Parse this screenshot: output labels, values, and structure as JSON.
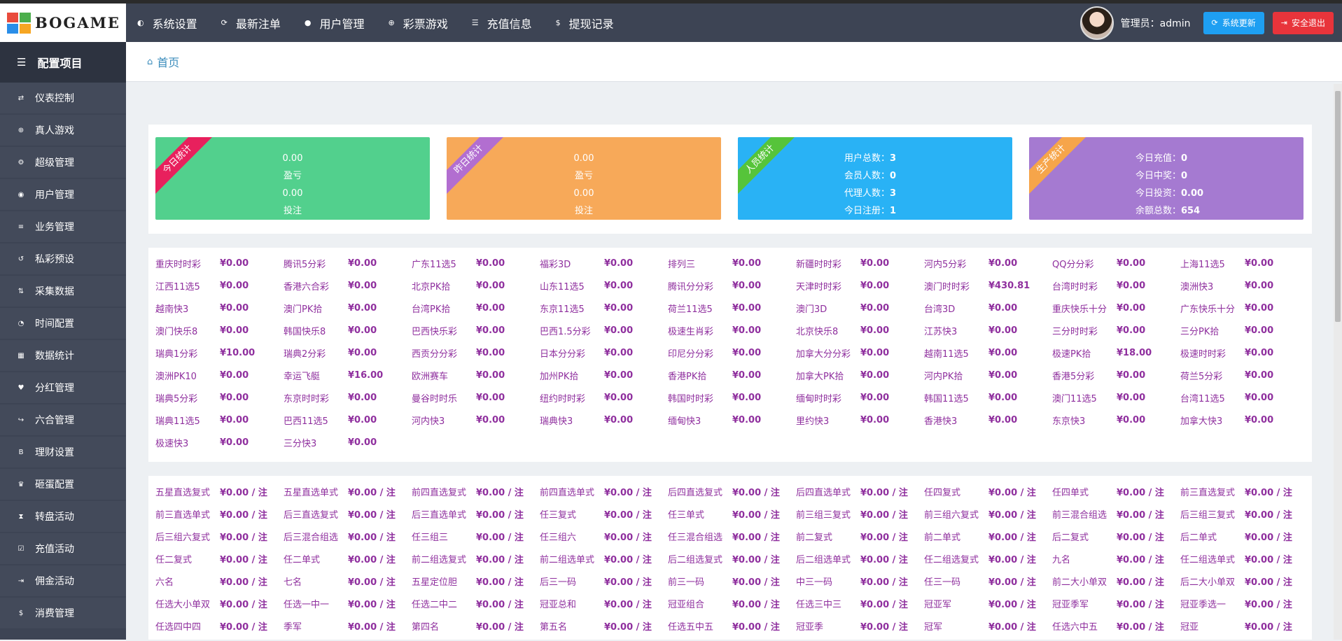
{
  "header": {
    "logo_text": "BOGAME",
    "logo_colors": [
      "#e94b3c",
      "#f6a623",
      "#4cae4c",
      "#2a8ee8"
    ],
    "nav": [
      {
        "label": "系统设置",
        "icon": "toggle-icon"
      },
      {
        "label": "最新注单",
        "icon": "refresh-icon"
      },
      {
        "label": "用户管理",
        "icon": "user-icon"
      },
      {
        "label": "彩票游戏",
        "icon": "plus-circle-icon"
      },
      {
        "label": "充值信息",
        "icon": "list-icon"
      },
      {
        "label": "提现记录",
        "icon": "dollar-icon"
      }
    ],
    "admin_label": "管理员：admin",
    "update_button": "系统更新",
    "logout_button": "安全退出"
  },
  "sidebar": {
    "title": "配置项目",
    "items": [
      {
        "label": "仪表控制",
        "icon": "shuffle-icon"
      },
      {
        "label": "真人游戏",
        "icon": "plus-circle-icon"
      },
      {
        "label": "超级管理",
        "icon": "gear-icon"
      },
      {
        "label": "用户管理",
        "icon": "user-circle-icon"
      },
      {
        "label": "业务管理",
        "icon": "list-icon"
      },
      {
        "label": "私彩预设",
        "icon": "undo-icon"
      },
      {
        "label": "采集数据",
        "icon": "sort-icon"
      },
      {
        "label": "时间配置",
        "icon": "dashboard-icon"
      },
      {
        "label": "数据统计",
        "icon": "chart-icon"
      },
      {
        "label": "分红管理",
        "icon": "heart-icon"
      },
      {
        "label": "六合管理",
        "icon": "share-icon"
      },
      {
        "label": "理财设置",
        "icon": "bitcoin-icon"
      },
      {
        "label": "砸蛋配置",
        "icon": "trophy-icon"
      },
      {
        "label": "转盘活动",
        "icon": "hourglass-icon"
      },
      {
        "label": "充值活动",
        "icon": "check-square-icon"
      },
      {
        "label": "佣金活动",
        "icon": "sign-out-icon"
      },
      {
        "label": "消费管理",
        "icon": "dollar-icon"
      }
    ]
  },
  "breadcrumb": {
    "home": "首页"
  },
  "stats": [
    {
      "ribbon": "今日统计",
      "bg": "#52d08d",
      "ribbon_bg": "#e8205d",
      "lines": [
        "0.00",
        "盈亏",
        "0.00",
        "投注"
      ]
    },
    {
      "ribbon": "昨日统计",
      "bg": "#f7a959",
      "ribbon_bg": "#b26ed0",
      "lines": [
        "0.00",
        "盈亏",
        "0.00",
        "投注"
      ]
    },
    {
      "ribbon": "人员统计",
      "bg": "#29b2f5",
      "ribbon_bg": "#56c43a",
      "kv": [
        {
          "k": "用户总数：",
          "v": "3"
        },
        {
          "k": "会员人数：",
          "v": "0"
        },
        {
          "k": "代理人数：",
          "v": "3"
        },
        {
          "k": "今日注册：",
          "v": "1"
        }
      ]
    },
    {
      "ribbon": "生产统计",
      "bg": "#a57ad1",
      "ribbon_bg": "#f6a54a",
      "kv": [
        {
          "k": "今日充值：",
          "v": "0"
        },
        {
          "k": "今日中奖：",
          "v": "0"
        },
        {
          "k": "今日投资：",
          "v": "0.00"
        },
        {
          "k": "余额总数：",
          "v": "654"
        }
      ]
    }
  ],
  "lotteries": [
    [
      "重庆时时彩",
      "¥0.00"
    ],
    [
      "腾讯5分彩",
      "¥0.00"
    ],
    [
      "广东11选5",
      "¥0.00"
    ],
    [
      "福彩3D",
      "¥0.00"
    ],
    [
      "排列三",
      "¥0.00"
    ],
    [
      "新疆时时彩",
      "¥0.00"
    ],
    [
      "河内5分彩",
      "¥0.00"
    ],
    [
      "QQ分分彩",
      "¥0.00"
    ],
    [
      "上海11选5",
      "¥0.00"
    ],
    [
      "江西11选5",
      "¥0.00"
    ],
    [
      "香港六合彩",
      "¥0.00"
    ],
    [
      "北京PK拾",
      "¥0.00"
    ],
    [
      "山东11选5",
      "¥0.00"
    ],
    [
      "腾讯分分彩",
      "¥0.00"
    ],
    [
      "天津时时彩",
      "¥0.00"
    ],
    [
      "澳门时时彩",
      "¥430.81"
    ],
    [
      "台湾时时彩",
      "¥0.00"
    ],
    [
      "澳洲快3",
      "¥0.00"
    ],
    [
      "越南快3",
      "¥0.00"
    ],
    [
      "澳门PK拾",
      "¥0.00"
    ],
    [
      "台湾PK拾",
      "¥0.00"
    ],
    [
      "东京11选5",
      "¥0.00"
    ],
    [
      "荷兰11选5",
      "¥0.00"
    ],
    [
      "澳门3D",
      "¥0.00"
    ],
    [
      "台湾3D",
      "¥0.00"
    ],
    [
      "重庆快乐十分",
      "¥0.00"
    ],
    [
      "广东快乐十分",
      "¥0.00"
    ],
    [
      "澳门快乐8",
      "¥0.00"
    ],
    [
      "韩国快乐8",
      "¥0.00"
    ],
    [
      "巴西快乐彩",
      "¥0.00"
    ],
    [
      "巴西1.5分彩",
      "¥0.00"
    ],
    [
      "极速生肖彩",
      "¥0.00"
    ],
    [
      "北京快乐8",
      "¥0.00"
    ],
    [
      "江苏快3",
      "¥0.00"
    ],
    [
      "三分时时彩",
      "¥0.00"
    ],
    [
      "三分PK拾",
      "¥0.00"
    ],
    [
      "瑞典1分彩",
      "¥10.00"
    ],
    [
      "瑞典2分彩",
      "¥0.00"
    ],
    [
      "西贡分分彩",
      "¥0.00"
    ],
    [
      "日本分分彩",
      "¥0.00"
    ],
    [
      "印尼分分彩",
      "¥0.00"
    ],
    [
      "加拿大分分彩",
      "¥0.00"
    ],
    [
      "越南11选5",
      "¥0.00"
    ],
    [
      "极速PK拾",
      "¥18.00"
    ],
    [
      "极速时时彩",
      "¥0.00"
    ],
    [
      "澳洲PK10",
      "¥0.00"
    ],
    [
      "幸运飞艇",
      "¥16.00"
    ],
    [
      "欧洲赛车",
      "¥0.00"
    ],
    [
      "加州PK拾",
      "¥0.00"
    ],
    [
      "香港PK拾",
      "¥0.00"
    ],
    [
      "加拿大PK拾",
      "¥0.00"
    ],
    [
      "河内PK拾",
      "¥0.00"
    ],
    [
      "香港5分彩",
      "¥0.00"
    ],
    [
      "荷兰5分彩",
      "¥0.00"
    ],
    [
      "瑞典5分彩",
      "¥0.00"
    ],
    [
      "东京时时彩",
      "¥0.00"
    ],
    [
      "曼谷时时乐",
      "¥0.00"
    ],
    [
      "纽约时时彩",
      "¥0.00"
    ],
    [
      "韩国时时彩",
      "¥0.00"
    ],
    [
      "缅甸时时彩",
      "¥0.00"
    ],
    [
      "韩国11选5",
      "¥0.00"
    ],
    [
      "澳门11选5",
      "¥0.00"
    ],
    [
      "台湾11选5",
      "¥0.00"
    ],
    [
      "瑞典11选5",
      "¥0.00"
    ],
    [
      "巴西11选5",
      "¥0.00"
    ],
    [
      "河内快3",
      "¥0.00"
    ],
    [
      "瑞典快3",
      "¥0.00"
    ],
    [
      "缅甸快3",
      "¥0.00"
    ],
    [
      "里约快3",
      "¥0.00"
    ],
    [
      "香港快3",
      "¥0.00"
    ],
    [
      "东京快3",
      "¥0.00"
    ],
    [
      "加拿大快3",
      "¥0.00"
    ],
    [
      "极速快3",
      "¥0.00"
    ],
    [
      "三分快3",
      "¥0.00"
    ]
  ],
  "plays": [
    [
      "五星直选复式",
      "¥0.00 / 注"
    ],
    [
      "五星直选单式",
      "¥0.00 / 注"
    ],
    [
      "前四直选复式",
      "¥0.00 / 注"
    ],
    [
      "前四直选单式",
      "¥0.00 / 注"
    ],
    [
      "后四直选复式",
      "¥0.00 / 注"
    ],
    [
      "后四直选单式",
      "¥0.00 / 注"
    ],
    [
      "任四复式",
      "¥0.00 / 注"
    ],
    [
      "任四单式",
      "¥0.00 / 注"
    ],
    [
      "前三直选复式",
      "¥0.00 / 注"
    ],
    [
      "前三直选单式",
      "¥0.00 / 注"
    ],
    [
      "后三直选复式",
      "¥0.00 / 注"
    ],
    [
      "后三直选单式",
      "¥0.00 / 注"
    ],
    [
      "任三复式",
      "¥0.00 / 注"
    ],
    [
      "任三单式",
      "¥0.00 / 注"
    ],
    [
      "前三组三复式",
      "¥0.00 / 注"
    ],
    [
      "前三组六复式",
      "¥0.00 / 注"
    ],
    [
      "前三混合组选",
      "¥0.00 / 注"
    ],
    [
      "后三组三复式",
      "¥0.00 / 注"
    ],
    [
      "后三组六复式",
      "¥0.00 / 注"
    ],
    [
      "后三混合组选",
      "¥0.00 / 注"
    ],
    [
      "任三组三",
      "¥0.00 / 注"
    ],
    [
      "任三组六",
      "¥0.00 / 注"
    ],
    [
      "任三混合组选",
      "¥0.00 / 注"
    ],
    [
      "前二复式",
      "¥0.00 / 注"
    ],
    [
      "前二单式",
      "¥0.00 / 注"
    ],
    [
      "后二复式",
      "¥0.00 / 注"
    ],
    [
      "后二单式",
      "¥0.00 / 注"
    ],
    [
      "任二复式",
      "¥0.00 / 注"
    ],
    [
      "任二单式",
      "¥0.00 / 注"
    ],
    [
      "前二组选复式",
      "¥0.00 / 注"
    ],
    [
      "前二组选单式",
      "¥0.00 / 注"
    ],
    [
      "后二组选复式",
      "¥0.00 / 注"
    ],
    [
      "后二组选单式",
      "¥0.00 / 注"
    ],
    [
      "任二组选复式",
      "¥0.00 / 注"
    ],
    [
      "九名",
      "¥0.00 / 注"
    ],
    [
      "任二组选单式",
      "¥0.00 / 注"
    ],
    [
      "六名",
      "¥0.00 / 注"
    ],
    [
      "七名",
      "¥0.00 / 注"
    ],
    [
      "五星定位胆",
      "¥0.00 / 注"
    ],
    [
      "后三一码",
      "¥0.00 / 注"
    ],
    [
      "前三一码",
      "¥0.00 / 注"
    ],
    [
      "中三一码",
      "¥0.00 / 注"
    ],
    [
      "任三一码",
      "¥0.00 / 注"
    ],
    [
      "前二大小单双",
      "¥0.00 / 注"
    ],
    [
      "后二大小单双",
      "¥0.00 / 注"
    ],
    [
      "任选大小单双",
      "¥0.00 / 注"
    ],
    [
      "任选一中一",
      "¥0.00 / 注"
    ],
    [
      "任选二中二",
      "¥0.00 / 注"
    ],
    [
      "冠亚总和",
      "¥0.00 / 注"
    ],
    [
      "冠亚组合",
      "¥0.00 / 注"
    ],
    [
      "任选三中三",
      "¥0.00 / 注"
    ],
    [
      "冠亚军",
      "¥0.00 / 注"
    ],
    [
      "冠亚季军",
      "¥0.00 / 注"
    ],
    [
      "冠亚季选一",
      "¥0.00 / 注"
    ],
    [
      "任选四中四",
      "¥0.00 / 注"
    ],
    [
      "季军",
      "¥0.00 / 注"
    ],
    [
      "第四名",
      "¥0.00 / 注"
    ],
    [
      "第五名",
      "¥0.00 / 注"
    ],
    [
      "任选五中五",
      "¥0.00 / 注"
    ],
    [
      "冠亚季",
      "¥0.00 / 注"
    ],
    [
      "冠军",
      "¥0.00 / 注"
    ],
    [
      "任选六中五",
      "¥0.00 / 注"
    ],
    [
      "冠亚",
      "¥0.00 / 注"
    ]
  ]
}
